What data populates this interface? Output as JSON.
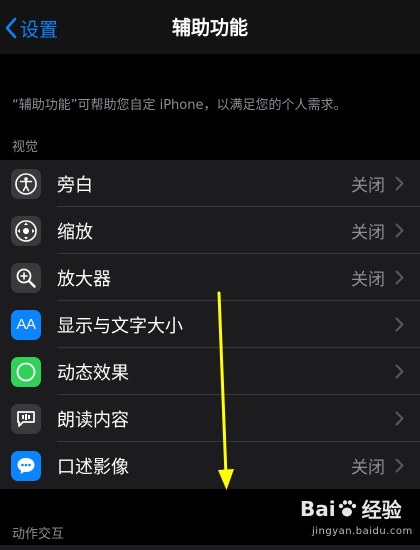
{
  "nav": {
    "back_label": "设置",
    "title": "辅助功能"
  },
  "description": "“辅助功能”可帮助您自定 iPhone，以满足您的个人需求。",
  "sections": {
    "vision": "视觉",
    "interaction": "动作交互"
  },
  "rows": [
    {
      "label": "旁白",
      "value": "关闭",
      "icon": "voiceover-icon"
    },
    {
      "label": "缩放",
      "value": "关闭",
      "icon": "zoom-icon"
    },
    {
      "label": "放大器",
      "value": "关闭",
      "icon": "magnifier-icon"
    },
    {
      "label": "显示与文字大小",
      "value": "",
      "icon": "text-size-icon",
      "icon_text": "AA"
    },
    {
      "label": "动态效果",
      "value": "",
      "icon": "motion-icon"
    },
    {
      "label": "朗读内容",
      "value": "",
      "icon": "spoken-content-icon"
    },
    {
      "label": "口述影像",
      "value": "关闭",
      "icon": "audio-description-icon"
    }
  ],
  "colors": {
    "accent": "#0a84ff",
    "annotation_arrow": "#ffff00",
    "icon_blue": "#0a84ff",
    "icon_green": "#30d158"
  },
  "watermark": {
    "brand": "Bai",
    "brand_cn": "经验",
    "url": "jingyan.baidu.com"
  }
}
